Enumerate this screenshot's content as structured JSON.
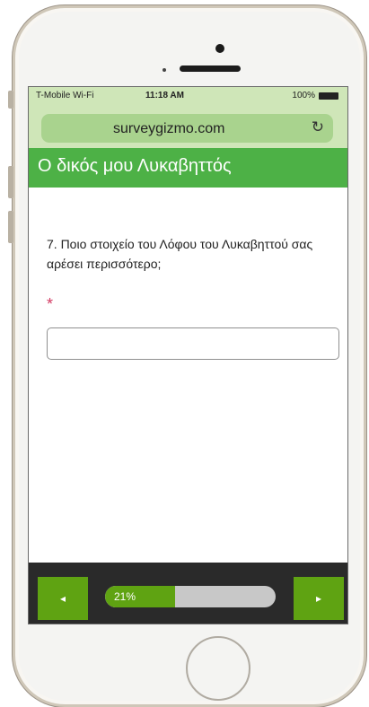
{
  "status_bar": {
    "carrier": "T-Mobile Wi-Fi",
    "time": "11:18 AM",
    "battery": "100%"
  },
  "browser": {
    "url": "surveygizmo.com",
    "reload_icon": "reload-icon"
  },
  "survey": {
    "title": "Ο δικός μου Λυκαβηττός",
    "question": "7. Ποιο στοιχείο του Λόφου του Λυκαβηττού σας αρέσει περισσότερο;",
    "required_marker": "*",
    "answer_value": ""
  },
  "footer": {
    "prev_label": "◂",
    "next_label": "▸",
    "progress_label": "21%",
    "progress_value": 0.41
  },
  "colors": {
    "header_green": "#4db146",
    "button_green": "#5fa312",
    "required_pink": "#d33b63"
  }
}
